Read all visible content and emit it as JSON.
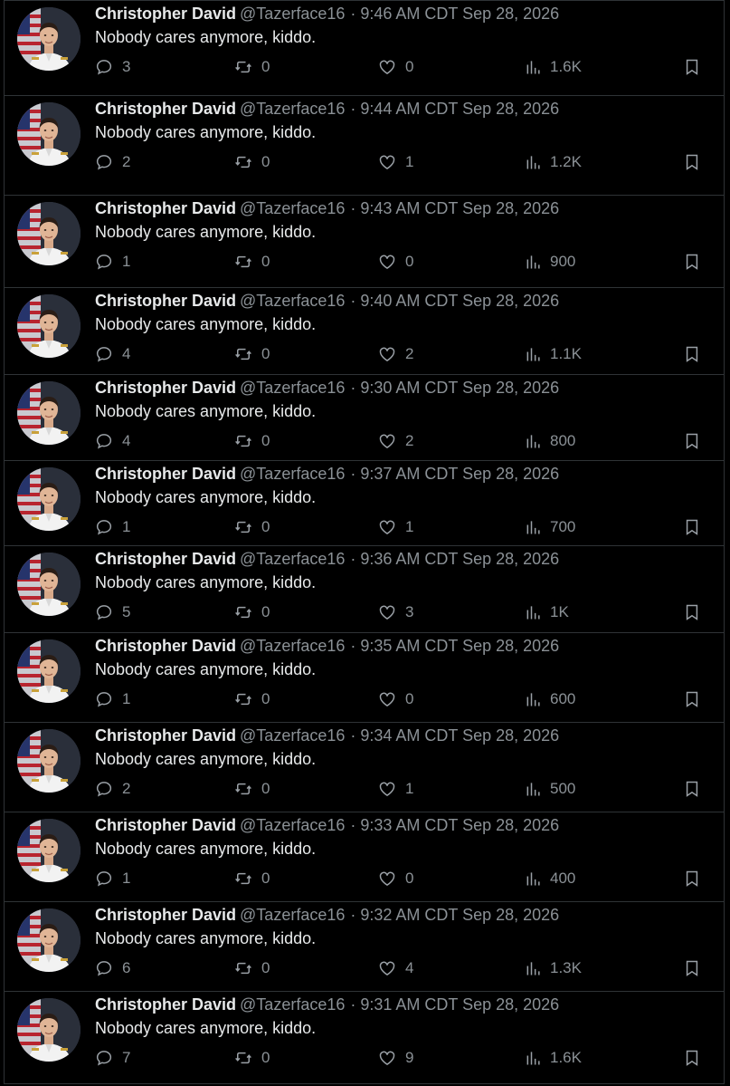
{
  "tweets": [
    {
      "name": "Christopher David",
      "handle": "@Tazerface16",
      "time": "9:46 AM CDT Sep 28, 2026",
      "text": "Nobody cares anymore, kiddo.",
      "replies": "3",
      "retweets": "0",
      "likes": "0",
      "views": "1.6K"
    },
    {
      "name": "Christopher David",
      "handle": "@Tazerface16",
      "time": "9:44 AM CDT Sep 28, 2026",
      "text": "Nobody cares anymore, kiddo.",
      "replies": "2",
      "retweets": "0",
      "likes": "1",
      "views": "1.2K"
    },
    {
      "name": "Christopher David",
      "handle": "@Tazerface16",
      "time": "9:43 AM CDT Sep 28, 2026",
      "text": "Nobody cares anymore, kiddo.",
      "replies": "1",
      "retweets": "0",
      "likes": "0",
      "views": "900"
    },
    {
      "name": "Christopher David",
      "handle": "@Tazerface16",
      "time": "9:40 AM CDT Sep 28, 2026",
      "text": "Nobody cares anymore, kiddo.",
      "replies": "4",
      "retweets": "0",
      "likes": "2",
      "views": "1.1K"
    },
    {
      "name": "Christopher David",
      "handle": "@Tazerface16",
      "time": "9:30 AM CDT Sep 28, 2026",
      "text": "Nobody cares anymore, kiddo.",
      "replies": "4",
      "retweets": "0",
      "likes": "2",
      "views": "800"
    },
    {
      "name": "Christopher David",
      "handle": "@Tazerface16",
      "time": "9:37 AM CDT Sep 28, 2026",
      "text": "Nobody cares anymore, kiddo.",
      "replies": "1",
      "retweets": "0",
      "likes": "1",
      "views": "700"
    },
    {
      "name": "Christopher David",
      "handle": "@Tazerface16",
      "time": "9:36 AM CDT Sep 28, 2026",
      "text": "Nobody cares anymore, kiddo.",
      "replies": "5",
      "retweets": "0",
      "likes": "3",
      "views": "1K"
    },
    {
      "name": "Christopher David",
      "handle": "@Tazerface16",
      "time": "9:35 AM CDT Sep 28, 2026",
      "text": "Nobody cares anymore, kiddo.",
      "replies": "1",
      "retweets": "0",
      "likes": "0",
      "views": "600"
    },
    {
      "name": "Christopher David",
      "handle": "@Tazerface16",
      "time": "9:34 AM CDT Sep 28, 2026",
      "text": "Nobody cares anymore, kiddo.",
      "replies": "2",
      "retweets": "0",
      "likes": "1",
      "views": "500"
    },
    {
      "name": "Christopher David",
      "handle": "@Tazerface16",
      "time": "9:33 AM CDT Sep 28, 2026",
      "text": "Nobody cares anymore, kiddo.",
      "replies": "1",
      "retweets": "0",
      "likes": "0",
      "views": "400"
    },
    {
      "name": "Christopher David",
      "handle": "@Tazerface16",
      "time": "9:32 AM CDT Sep 28, 2026",
      "text": "Nobody cares anymore, kiddo.",
      "replies": "6",
      "retweets": "0",
      "likes": "4",
      "views": "1.3K"
    },
    {
      "name": "Christopher David",
      "handle": "@Tazerface16",
      "time": "9:31 AM CDT Sep 28, 2026",
      "text": "Nobody cares anymore, kiddo.",
      "replies": "7",
      "retweets": "0",
      "likes": "9",
      "views": "1.6K"
    }
  ],
  "separator": "·",
  "icons": {
    "reply": "reply-icon",
    "retweet": "retweet-icon",
    "like": "heart-icon",
    "views": "views-chart-icon",
    "bookmark": "bookmark-icon"
  },
  "colors": {
    "background": "#000000",
    "text": "#e7e9ea",
    "muted": "#8b9196",
    "border": "#2f3336"
  }
}
